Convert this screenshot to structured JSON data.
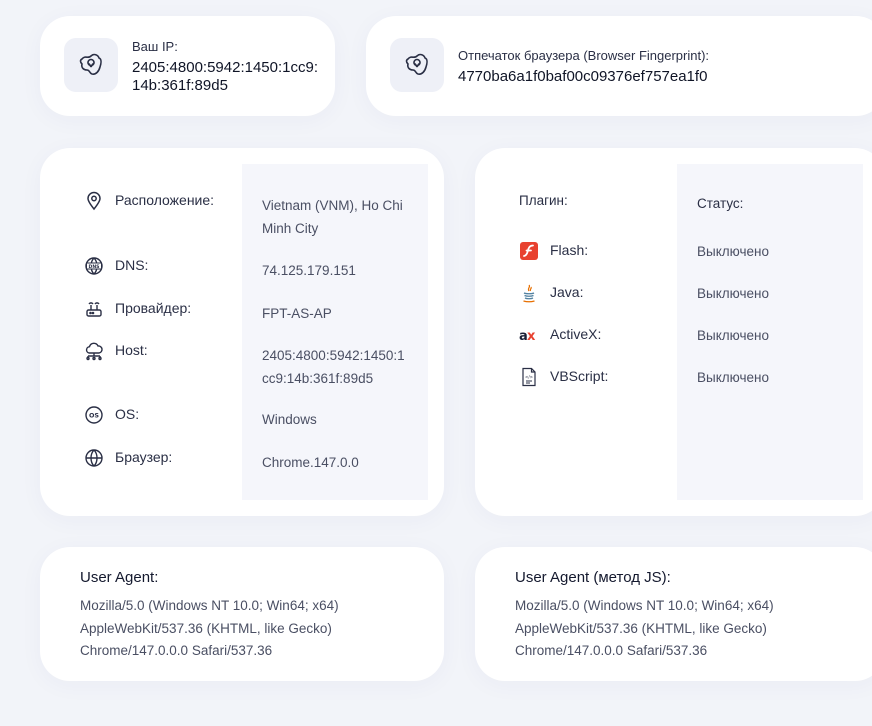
{
  "ip": {
    "label": "Ваш IP:",
    "value": "2405:4800:5942:1450:1cc9:14b:361f:89d5"
  },
  "fingerprint": {
    "label": "Отпечаток браузера (Browser Fingerprint):",
    "value": "4770ba6a1f0baf00c09376ef757ea1f0"
  },
  "info": {
    "rows": [
      {
        "icon": "location-pin-icon",
        "label": "Расположение:",
        "value": "Vietnam (VNM), Ho Chi Minh City"
      },
      {
        "icon": "dns-icon",
        "label": "DNS:",
        "value": "74.125.179.151"
      },
      {
        "icon": "router-icon",
        "label": "Провайдер:",
        "value": "FPT-AS-AP"
      },
      {
        "icon": "cloud-network-icon",
        "label": "Host:",
        "value": "2405:4800:5942:1450:1cc9:14b:361f:89d5"
      },
      {
        "icon": "os-icon",
        "label": "OS:",
        "value": "Windows"
      },
      {
        "icon": "globe-icon",
        "label": "Браузер:",
        "value": "Chrome.147.0.0"
      }
    ]
  },
  "plugins": {
    "plugin_header": "Плагин:",
    "status_header": "Статус:",
    "rows": [
      {
        "icon": "flash-icon",
        "label": "Flash:",
        "value": "Выключено"
      },
      {
        "icon": "java-icon",
        "label": "Java:",
        "value": "Выключено"
      },
      {
        "icon": "activex-icon",
        "label": "ActiveX:",
        "value": "Выключено"
      },
      {
        "icon": "vbscript-icon",
        "label": "VBScript:",
        "value": "Выключено"
      }
    ]
  },
  "user_agent": {
    "title": "User Agent:",
    "value": "Mozilla/5.0 (Windows NT 10.0; Win64; x64) AppleWebKit/537.36 (KHTML, like Gecko) Chrome/147.0.0.0 Safari/537.36"
  },
  "user_agent_js": {
    "title": "User Agent (метод JS):",
    "value": "Mozilla/5.0 (Windows NT 10.0; Win64; x64) AppleWebKit/537.36 (KHTML, like Gecko) Chrome/147.0.0.0 Safari/537.36"
  },
  "colors": {
    "background": "#f2f4f9",
    "card": "#ffffff",
    "shade": "#f5f6fb",
    "flash": "#e8412f",
    "java_red": "#e76f00",
    "java_blue": "#5382a1"
  }
}
